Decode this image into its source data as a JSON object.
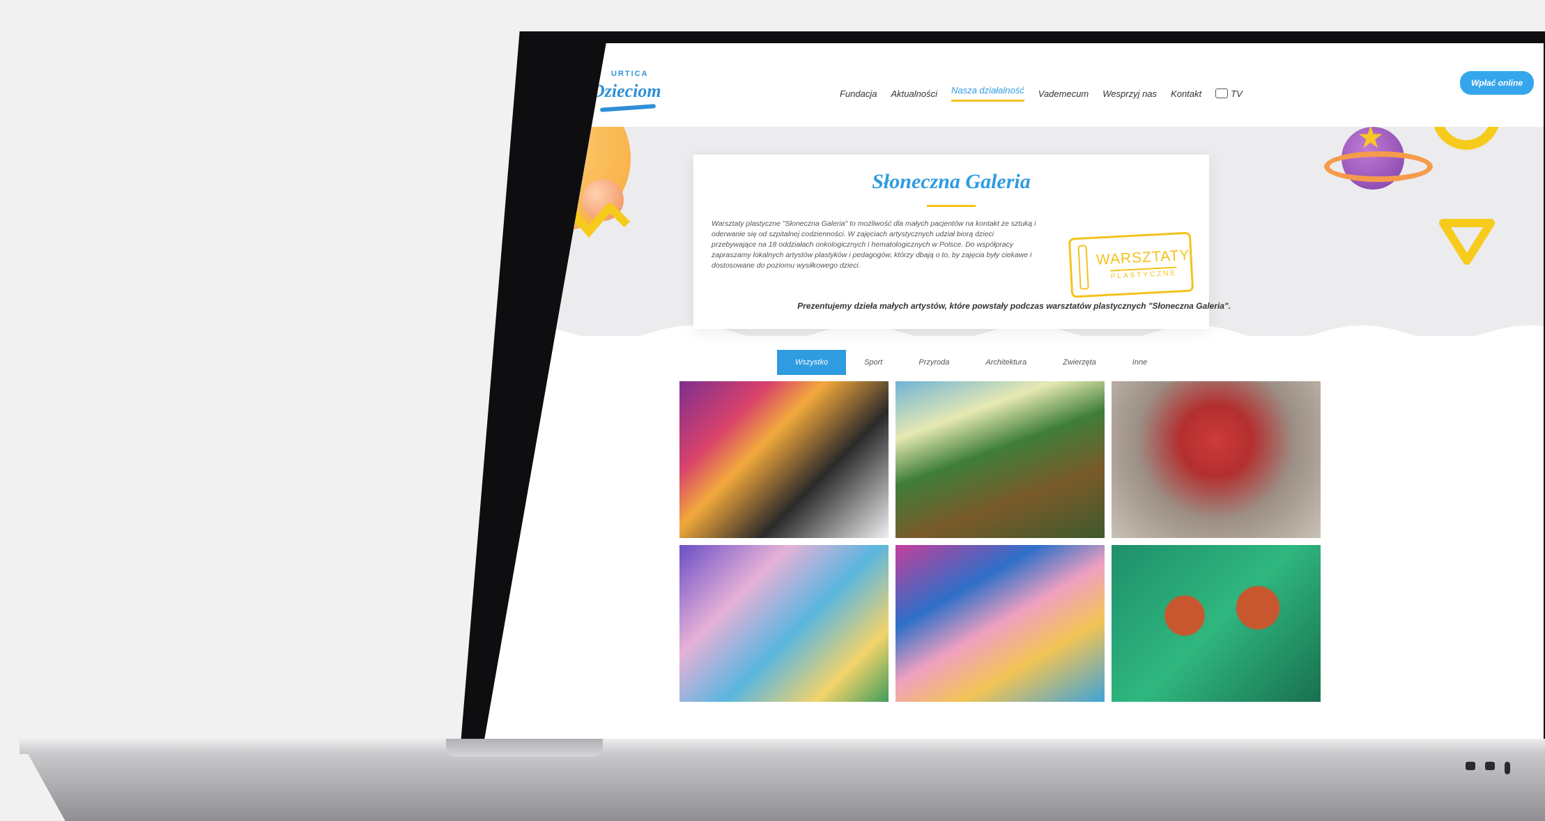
{
  "header": {
    "logo_top": "URTICA",
    "logo_main": "Dzieciom",
    "nav": [
      {
        "label": "Fundacja"
      },
      {
        "label": "Aktualności"
      },
      {
        "label": "Nasza działalność"
      },
      {
        "label": "Vademecum"
      },
      {
        "label": "Wesprzyj nas"
      },
      {
        "label": "Kontakt"
      },
      {
        "label": "TV"
      }
    ],
    "donate_label": "Wpłać online"
  },
  "hero": {
    "title": "Słoneczna Galeria",
    "description": "Warsztaty plastyczne \"Słoneczna Galeria\" to możliwość dla małych pacjentów na kontakt ze sztuką i oderwanie się od szpitalnej codzienności. W zajęciach artystycznych udział biorą dzieci przebywające na 18 oddziałach onkologicznych i hematologicznych w Polsce. Do współpracy zapraszamy lokalnych artystów plastyków i pedagogów, którzy dbają o to, by zajęcia były ciekawe i dostosowane do poziomu wysiłkowego dzieci.",
    "stamp_big": "WARSZTATY",
    "stamp_small": "PLASTYCZNE",
    "intro": "Prezentujemy dzieła małych artystów, które powstały podczas warsztatów plastycznych \"Słoneczna Galeria\"."
  },
  "tabs": [
    {
      "label": "Wszystko",
      "active": true
    },
    {
      "label": "Sport"
    },
    {
      "label": "Przyroda"
    },
    {
      "label": "Architektura"
    },
    {
      "label": "Zwierzęta"
    },
    {
      "label": "Inne"
    }
  ],
  "colors": {
    "accent_blue": "#2f9be0",
    "accent_yellow": "#f4c21c"
  }
}
